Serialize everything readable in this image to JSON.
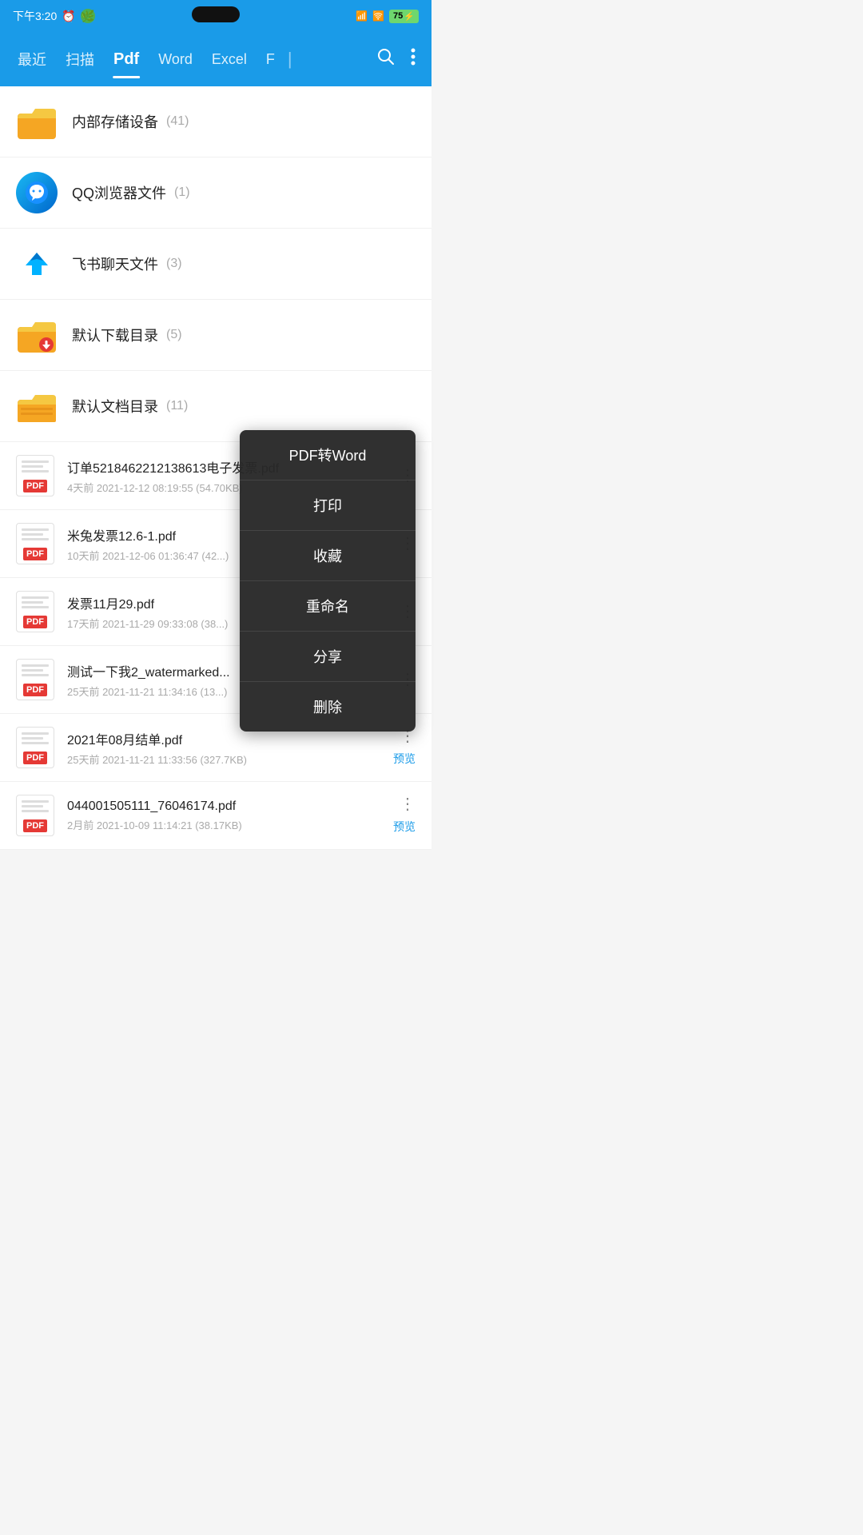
{
  "statusBar": {
    "time": "下午3:20",
    "battery": "75"
  },
  "nav": {
    "items": [
      {
        "label": "最近",
        "active": false
      },
      {
        "label": "扫描",
        "active": false
      },
      {
        "label": "Pdf",
        "active": true
      },
      {
        "label": "Word",
        "active": false
      },
      {
        "label": "Excel",
        "active": false
      },
      {
        "label": "F",
        "active": false
      }
    ]
  },
  "folders": [
    {
      "name": "内部存储设备",
      "count": "(41)",
      "type": "storage"
    },
    {
      "name": "QQ浏览器文件",
      "count": "(1)",
      "type": "qq"
    },
    {
      "name": "飞书聊天文件",
      "count": "(3)",
      "type": "feishu"
    },
    {
      "name": "默认下载目录",
      "count": "(5)",
      "type": "download"
    },
    {
      "name": "默认文档目录",
      "count": "(11)",
      "type": "docs"
    }
  ],
  "files": [
    {
      "name": "订单5218462212138613电子发票.pdf",
      "meta": "4天前 2021-12-12 08:19:55 (54.70KB)",
      "hasMenu": true,
      "hasPreview": false,
      "menuOpen": true
    },
    {
      "name": "米兔发票12.6-1.pdf",
      "meta": "10天前 2021-12-06 01:36:47 (42...)",
      "hasMenu": true,
      "hasPreview": false,
      "menuOpen": false
    },
    {
      "name": "发票11月29.pdf",
      "meta": "17天前 2021-11-29 09:33:08 (38...)",
      "hasMenu": true,
      "hasPreview": false,
      "menuOpen": false
    },
    {
      "name": "测试一下我2_watermarked...",
      "meta": "25天前 2021-11-21 11:34:16 (13...)",
      "hasMenu": true,
      "hasPreview": false,
      "menuOpen": false
    },
    {
      "name": "2021年08月结单.pdf",
      "meta": "25天前 2021-11-21 11:33:56 (327.7KB)",
      "hasMenu": true,
      "hasPreview": true,
      "menuOpen": false
    },
    {
      "name": "044001505111_76046174.pdf",
      "meta": "2月前 2021-10-09 11:14:21 (38.17KB)",
      "hasMenu": true,
      "hasPreview": true,
      "menuOpen": false
    }
  ],
  "contextMenu": {
    "items": [
      "PDF转Word",
      "打印",
      "收藏",
      "重命名",
      "分享",
      "删除"
    ]
  },
  "labels": {
    "preview": "预览",
    "search": "🔍",
    "more": "⋮"
  }
}
